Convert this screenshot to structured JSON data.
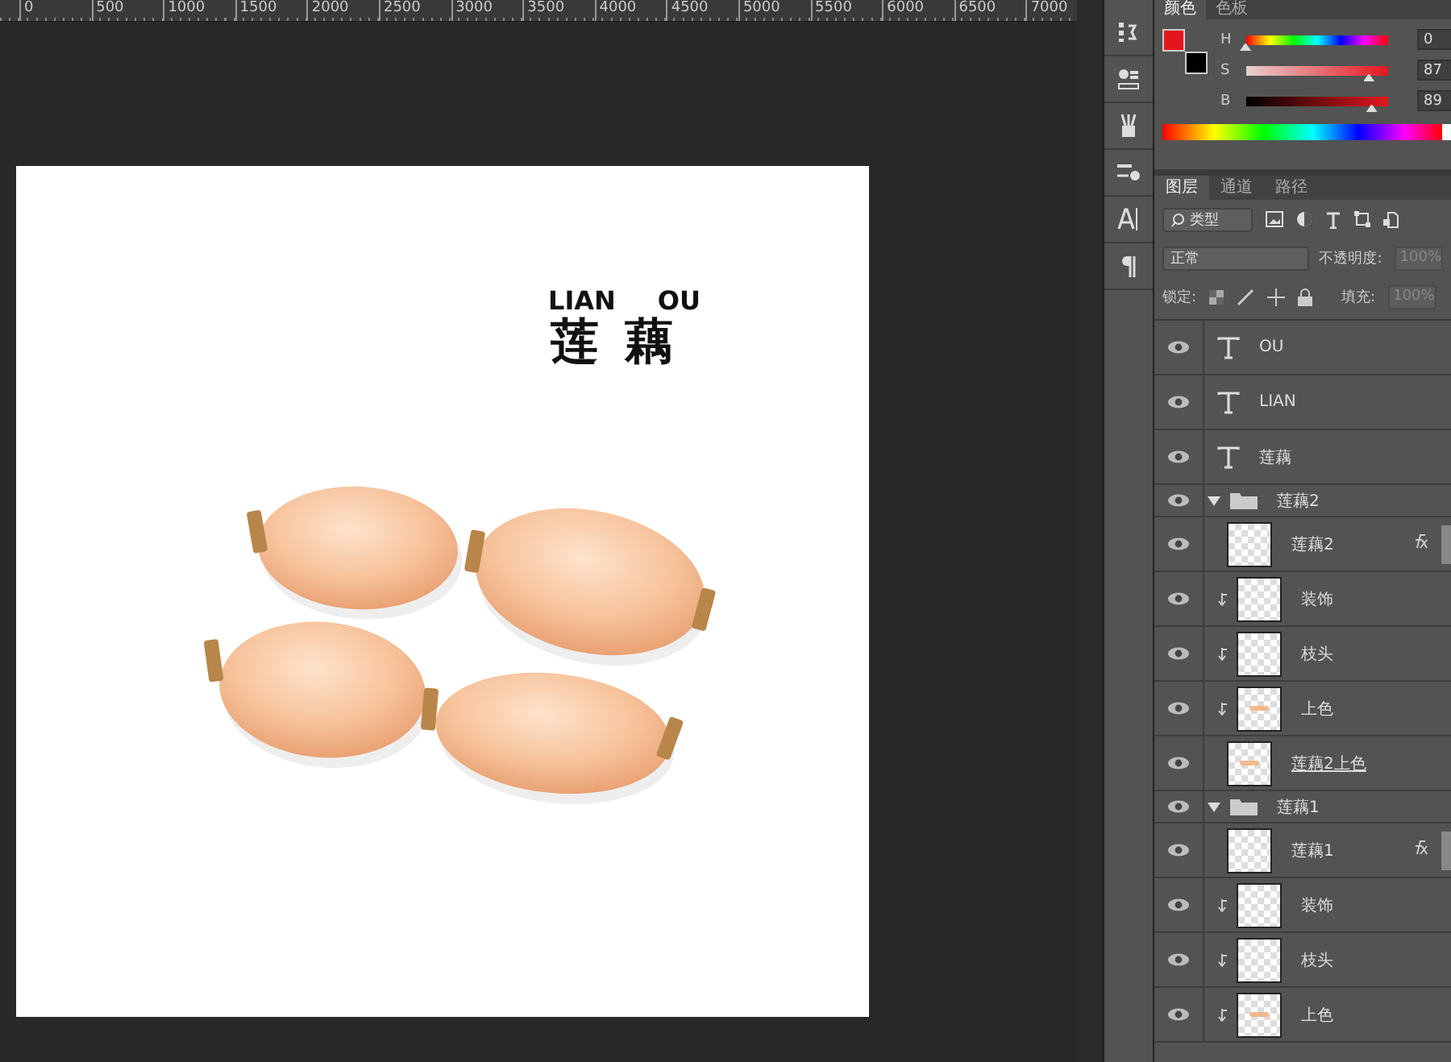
{
  "ruler": {
    "ticks": [
      "0",
      "500",
      "1000",
      "1500",
      "2000",
      "2500",
      "3000",
      "3500",
      "4000",
      "4500",
      "5000",
      "5500",
      "6000",
      "6500",
      "7000"
    ]
  },
  "document": {
    "title_latin": [
      "LIAN",
      "OU"
    ],
    "title_cjk": "莲藕"
  },
  "tools": [
    {
      "kind": "history"
    },
    {
      "kind": "properties"
    },
    {
      "kind": "brushes"
    },
    {
      "kind": "brush-preset"
    },
    {
      "kind": "character"
    },
    {
      "kind": "paragraph"
    }
  ],
  "color_panel": {
    "tabs": [
      {
        "label": "颜色",
        "selected": true
      },
      {
        "label": "色板",
        "selected": false
      }
    ],
    "swatches": [
      {
        "kind": "foreground",
        "color": "#e3161e"
      },
      {
        "kind": "background",
        "color": "#000000"
      }
    ],
    "sliders": [
      {
        "label": "H",
        "value": "0",
        "level": 0
      },
      {
        "label": "S",
        "value": "87",
        "level": 0.87
      },
      {
        "label": "B",
        "value": "89",
        "level": 0.89
      }
    ]
  },
  "layers_panel": {
    "tabs": [
      {
        "label": "图层",
        "selected": true
      },
      {
        "label": "通道",
        "selected": false
      },
      {
        "label": "路径",
        "selected": false
      }
    ],
    "filter": "类型",
    "blend_mode": "正常",
    "opacity_label": "不透明度:",
    "opacity": "100%",
    "lock_label": "锁定:",
    "fill_label": "填充:",
    "fill": "100%",
    "layers": [
      {
        "kind": "text",
        "name": "OU",
        "visible": true
      },
      {
        "kind": "text",
        "name": "LIAN",
        "visible": true
      },
      {
        "kind": "text",
        "name": "莲藕",
        "visible": true
      },
      {
        "kind": "group",
        "name": "莲藕2",
        "visible": true,
        "expanded": true,
        "children": [
          {
            "kind": "layer",
            "name": "莲藕2",
            "visible": true,
            "fx": true,
            "clipped": false,
            "thumb": false,
            "underlined": false
          },
          {
            "kind": "layer",
            "name": "装饰",
            "visible": true,
            "fx": false,
            "clipped": true,
            "thumb": false,
            "underlined": false
          },
          {
            "kind": "layer",
            "name": "枝头",
            "visible": true,
            "fx": false,
            "clipped": true,
            "thumb": false,
            "underlined": false
          },
          {
            "kind": "layer",
            "name": "上色",
            "visible": true,
            "fx": false,
            "clipped": true,
            "thumb": true,
            "underlined": false
          },
          {
            "kind": "layer",
            "name": "莲藕2上色",
            "visible": true,
            "fx": false,
            "clipped": false,
            "thumb": true,
            "underlined": true
          }
        ]
      },
      {
        "kind": "group",
        "name": "莲藕1",
        "visible": true,
        "expanded": true,
        "children": [
          {
            "kind": "layer",
            "name": "莲藕1",
            "visible": true,
            "fx": true,
            "clipped": false,
            "thumb": false,
            "underlined": false
          },
          {
            "kind": "layer",
            "name": "装饰",
            "visible": true,
            "fx": false,
            "clipped": true,
            "thumb": false,
            "underlined": false
          },
          {
            "kind": "layer",
            "name": "枝头",
            "visible": true,
            "fx": false,
            "clipped": true,
            "thumb": false,
            "underlined": false
          },
          {
            "kind": "layer",
            "name": "上色",
            "visible": true,
            "fx": false,
            "clipped": true,
            "thumb": true,
            "underlined": false
          }
        ]
      }
    ]
  }
}
